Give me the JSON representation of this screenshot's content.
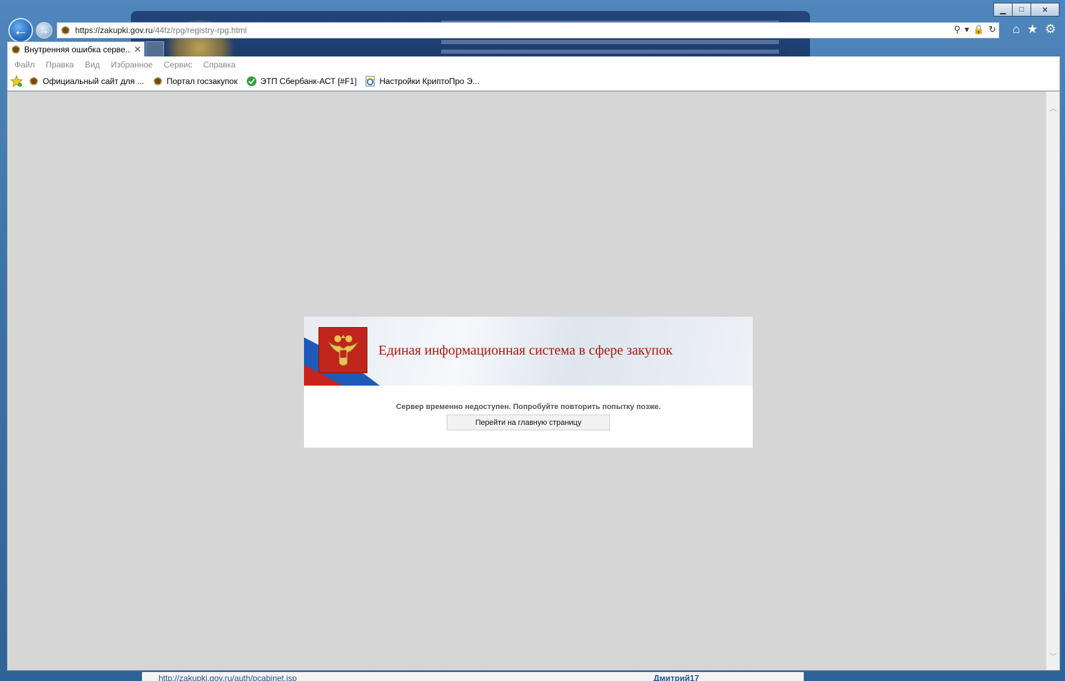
{
  "window": {
    "caption": {
      "minimize": "▁",
      "maximize": "□",
      "close": "✕"
    }
  },
  "nav": {
    "back_icon": "arrow-left-icon",
    "forward_icon": "arrow-right-icon",
    "address": {
      "host": "https://zakupki.gov.ru",
      "path": "/44fz/rpg/registry-rpg.html"
    },
    "address_tools": {
      "search": "⚲",
      "dropdown": "▾",
      "lock": "🔒",
      "refresh": "↻"
    },
    "right_tools": {
      "home": "⌂",
      "favorites": "★",
      "settings": "⚙"
    }
  },
  "tab": {
    "title": "Внутренняя ошибка серве...",
    "close": "✕"
  },
  "menu": {
    "items": [
      {
        "label": "Файл"
      },
      {
        "label": "Правка"
      },
      {
        "label": "Вид"
      },
      {
        "label": "Избранное"
      },
      {
        "label": "Сервис"
      },
      {
        "label": "Справка"
      }
    ]
  },
  "favorites": {
    "items": [
      {
        "label": "Официальный сайт для ...",
        "icon": "emblem-icon"
      },
      {
        "label": "Портал госзакупок",
        "icon": "emblem-icon"
      },
      {
        "label": "ЭТП Сбербанк-АСТ [#F1]",
        "icon": "sberbank-icon"
      },
      {
        "label": "Настройки КриптоПро Э...",
        "icon": "ie-icon"
      }
    ]
  },
  "main": {
    "card": {
      "title": "Единая информационная система в сфере закупок"
    },
    "error": {
      "message": "Сервер временно недоступен. Попробуйте повторить попытку позже.",
      "button_label": "Перейти на главную страницу"
    }
  },
  "background_page": {
    "link": "http://zakupki.gov.ru/auth/pcabinet.jsp",
    "user": "Дмитрий17"
  },
  "scroll": {
    "up": "︿",
    "down": "﹀"
  },
  "colors": {
    "accent_red": "#b3140c",
    "emblem_red": "#c0241a",
    "viewport_gray": "#d6d6d6"
  }
}
